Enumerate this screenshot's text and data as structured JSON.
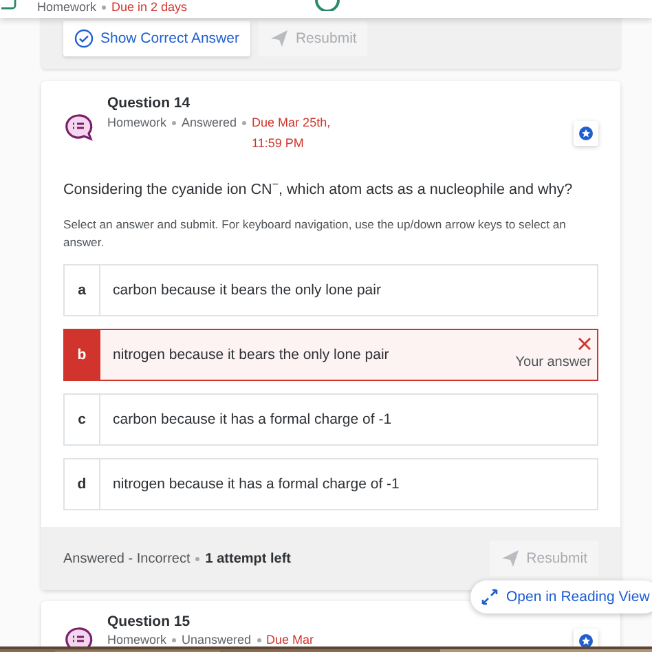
{
  "header": {
    "type": "Homework",
    "due": "Due in 2 days"
  },
  "previous_question": {
    "buttons": [
      {
        "kind": "check",
        "label": "Show Correct Answer",
        "disabled": false
      },
      {
        "kind": "send",
        "label": "Resubmit",
        "disabled": true
      }
    ]
  },
  "question": {
    "title": "Question 14",
    "type": "Homework",
    "status": "Answered",
    "due": "Due Mar 25th, 11:59 PM",
    "prompt": "Considering the cyanide ion CN$^{−}$, which atom acts as a nucleophile and why?",
    "instructions": "Select an answer and submit. For keyboard navigation, use the up/down arrow keys to select an answer.",
    "options": [
      {
        "letter": "a",
        "text": "carbon because it bears the only lone pair",
        "selected": false
      },
      {
        "letter": "b",
        "text": "nitrogen because it bears the only lone pair",
        "selected": true,
        "note": "Your answer"
      },
      {
        "letter": "c",
        "text": "carbon because it has a formal charge of -1",
        "selected": false
      },
      {
        "letter": "d",
        "text": "nitrogen because it has a formal charge of -1",
        "selected": false
      }
    ],
    "result": "Answered - Incorrect",
    "attempts": "1 attempt left",
    "button": {
      "label": "Resubmit",
      "disabled": true
    }
  },
  "next_question": {
    "title": "Question 15",
    "type": "Homework",
    "status": "Unanswered",
    "due": "Due Mar"
  },
  "reading_view": {
    "label": "Open in Reading View"
  }
}
